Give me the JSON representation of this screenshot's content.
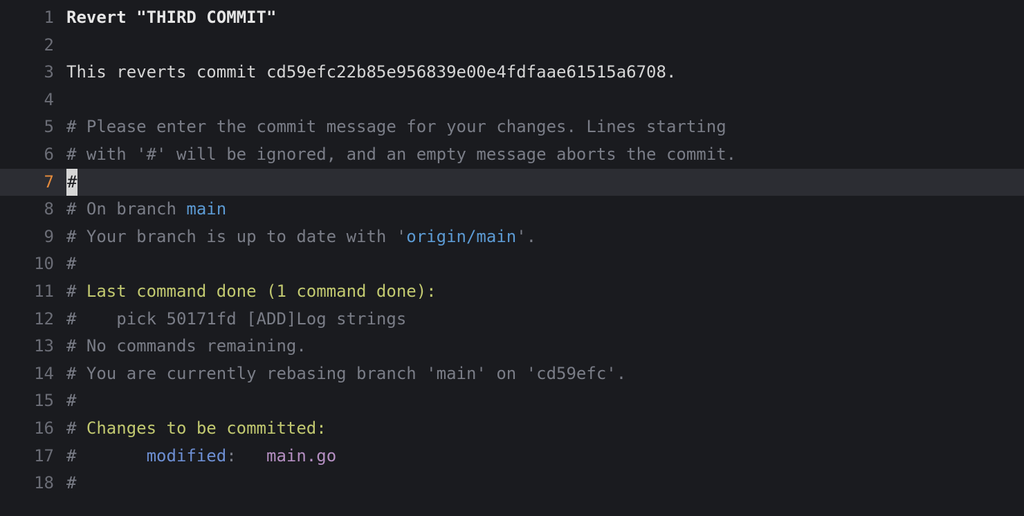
{
  "lines": [
    {
      "num": "1",
      "segments": [
        {
          "cls": "subject",
          "text": "Revert \"THIRD COMMIT\""
        }
      ]
    },
    {
      "num": "2",
      "segments": []
    },
    {
      "num": "3",
      "segments": [
        {
          "cls": "body-text",
          "text": "This reverts commit cd59efc22b85e956839e00e4fdfaae61515a6708."
        }
      ]
    },
    {
      "num": "4",
      "segments": []
    },
    {
      "num": "5",
      "segments": [
        {
          "cls": "hash",
          "text": "#"
        },
        {
          "cls": "comment",
          "text": " Please enter the commit message for your changes. Lines starting"
        }
      ]
    },
    {
      "num": "6",
      "segments": [
        {
          "cls": "hash",
          "text": "#"
        },
        {
          "cls": "comment",
          "text": " with '#' will be ignored, and an empty message aborts the commit."
        }
      ]
    },
    {
      "num": "7",
      "current": true,
      "segments": [
        {
          "cls": "cursor-block",
          "text": "#"
        }
      ]
    },
    {
      "num": "8",
      "segments": [
        {
          "cls": "hash",
          "text": "#"
        },
        {
          "cls": "comment",
          "text": " On branch "
        },
        {
          "cls": "branch",
          "text": "main"
        }
      ]
    },
    {
      "num": "9",
      "segments": [
        {
          "cls": "hash",
          "text": "#"
        },
        {
          "cls": "comment",
          "text": " Your branch is up to date with '"
        },
        {
          "cls": "branch",
          "text": "origin/main"
        },
        {
          "cls": "comment",
          "text": "'."
        }
      ]
    },
    {
      "num": "10",
      "segments": [
        {
          "cls": "hash",
          "text": "#"
        }
      ]
    },
    {
      "num": "11",
      "segments": [
        {
          "cls": "hash",
          "text": "#"
        },
        {
          "cls": "heading",
          "text": " Last command done (1 command done):"
        }
      ]
    },
    {
      "num": "12",
      "segments": [
        {
          "cls": "hash",
          "text": "#"
        },
        {
          "cls": "comment",
          "text": "    pick 50171fd [ADD]Log strings"
        }
      ]
    },
    {
      "num": "13",
      "segments": [
        {
          "cls": "hash",
          "text": "#"
        },
        {
          "cls": "comment",
          "text": " No commands remaining."
        }
      ]
    },
    {
      "num": "14",
      "segments": [
        {
          "cls": "hash",
          "text": "#"
        },
        {
          "cls": "comment",
          "text": " You are currently rebasing branch 'main' on 'cd59efc'."
        }
      ]
    },
    {
      "num": "15",
      "segments": [
        {
          "cls": "hash",
          "text": "#"
        }
      ]
    },
    {
      "num": "16",
      "segments": [
        {
          "cls": "hash",
          "text": "#"
        },
        {
          "cls": "heading",
          "text": " Changes to be committed:"
        }
      ]
    },
    {
      "num": "17",
      "segments": [
        {
          "cls": "hash",
          "text": "#"
        },
        {
          "cls": "comment",
          "text": "       "
        },
        {
          "cls": "mod",
          "text": "modified"
        },
        {
          "cls": "comment",
          "text": ":   "
        },
        {
          "cls": "file",
          "text": "main.go"
        }
      ]
    },
    {
      "num": "18",
      "segments": [
        {
          "cls": "hash",
          "text": "#"
        }
      ]
    }
  ]
}
